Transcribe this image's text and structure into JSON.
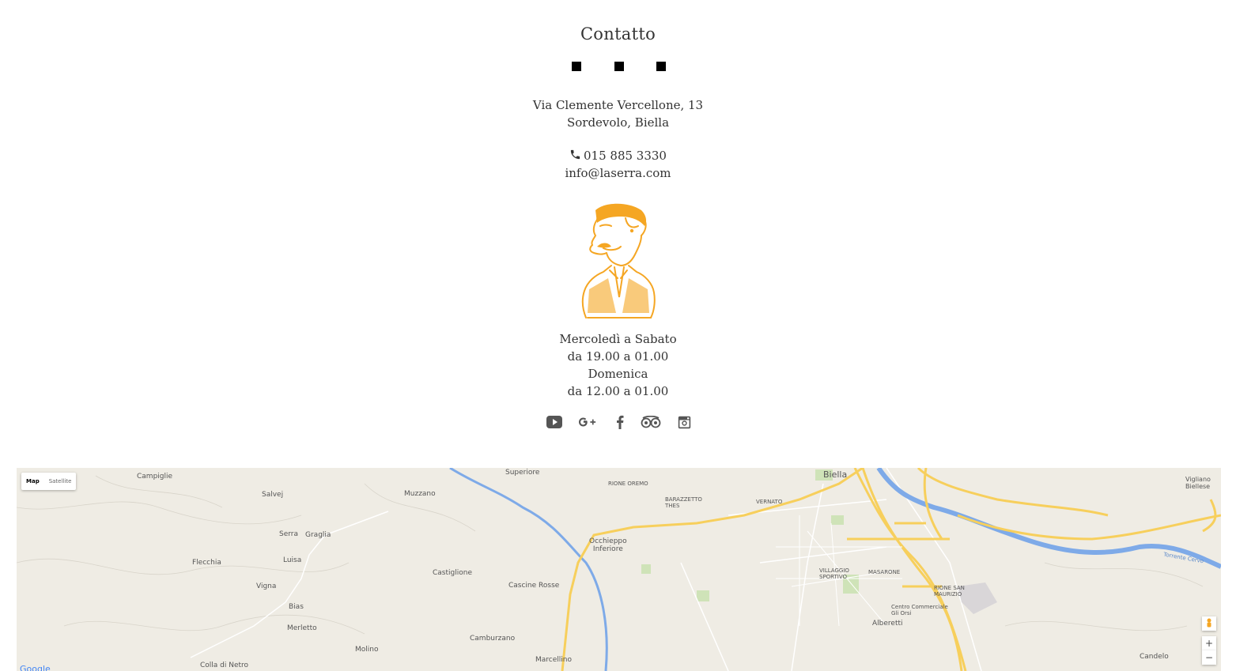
{
  "contact": {
    "title": "Contatto",
    "address_line1": "Via Clemente Vercellone, 13",
    "address_line2": "Sordevolo, Biella",
    "phone": "015 885 3330",
    "email": "info@laserra.com"
  },
  "hours": {
    "days1": "Mercoledì a Sabato",
    "time1": "da 19.00 a 01.00",
    "days2": "Domenica",
    "time2": "da 12.00 a 01.00"
  },
  "social": [
    "youtube-icon",
    "google-plus-icon",
    "facebook-icon",
    "tripadvisor-icon",
    "instagram-icon"
  ],
  "colors": {
    "mascot": "#f5a623",
    "text": "#333333",
    "road": "#f7cf5c",
    "river": "#7eaae8"
  },
  "map": {
    "type_map": "Map",
    "type_satellite": "Satellite",
    "zoom_in": "+",
    "zoom_out": "−",
    "logo": "Google",
    "places": [
      "Campiglie",
      "Salvej",
      "Muzzano",
      "Superiore",
      "RIONE OREMO",
      "BARAZZETTO THES",
      "VERNATO",
      "Biella",
      "Serra",
      "Graglia",
      "Flecchia",
      "Luisa",
      "Castiglione",
      "Occhieppo Inferiore",
      "Cascine Rosse",
      "Vigna",
      "Bias",
      "Merletto",
      "Molino",
      "Camburzano",
      "Marcellino",
      "Colla di Netro",
      "VILLAGGIO SPORTIVO",
      "MASARONE",
      "RIONE SAN MAURIZIO",
      "Centro Commerciale Gli Orsi",
      "Alberetti",
      "Candelo",
      "Vigliano Biellese",
      "Torrente Cervo"
    ]
  }
}
